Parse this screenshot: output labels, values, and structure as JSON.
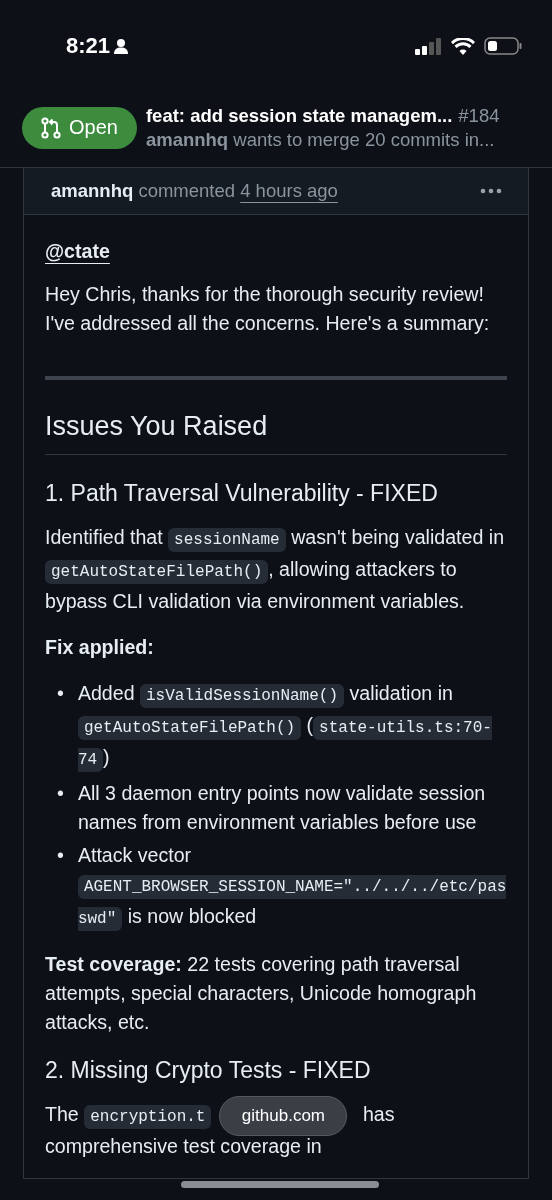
{
  "status_bar": {
    "time": "8:21"
  },
  "header": {
    "state": "Open",
    "title": "feat: add session state managem...",
    "number": "#184",
    "author": "amannhq",
    "subtitle": "wants to merge 20 commits in..."
  },
  "comment": {
    "author": "amannhq",
    "action": "commented",
    "time": "4 hours ago",
    "body": [
      {
        "kind": "mention",
        "text": "@ctate"
      },
      {
        "kind": "paragraph",
        "parts": [
          {
            "kind": "text",
            "text": "Hey Chris, thanks for the thorough security review! I've addressed all the concerns. Here's a summary:"
          }
        ]
      },
      {
        "kind": "rule"
      },
      {
        "kind": "h2",
        "text": "Issues You Raised"
      },
      {
        "kind": "h3",
        "text": "1. Path Traversal Vulnerability - FIXED"
      },
      {
        "kind": "paragraph",
        "parts": [
          {
            "kind": "text",
            "text": "Identified that "
          },
          {
            "kind": "code",
            "text": "sessionName"
          },
          {
            "kind": "text",
            "text": " wasn't being validated in "
          },
          {
            "kind": "code",
            "text": "getAutoStateFilePath()"
          },
          {
            "kind": "text",
            "text": ", allowing attackers to bypass CLI validation via environment variables."
          }
        ]
      },
      {
        "kind": "paragraph",
        "parts": [
          {
            "kind": "text",
            "text": "**Fix applied:**"
          }
        ]
      },
      {
        "kind": "list",
        "items": [
          {
            "bullet": "•",
            "parts": [
              {
                "kind": "text",
                "text": "Added "
              },
              {
                "kind": "code",
                "text": "isValidSessionName()"
              },
              {
                "kind": "text",
                "text": " validation in "
              },
              {
                "kind": "code",
                "text": "getAutoStateFilePath()"
              },
              {
                "kind": "text",
                "text": " ("
              },
              {
                "kind": "code",
                "text": "state-utils.ts:70-74"
              },
              {
                "kind": "text",
                "text": ")"
              }
            ]
          },
          {
            "bullet": "•",
            "parts": [
              {
                "kind": "text",
                "text": "All 3 daemon entry points now validate session names from environment variables before use"
              }
            ]
          },
          {
            "bullet": "•",
            "parts": [
              {
                "kind": "text",
                "text": "Attack vector "
              },
              {
                "kind": "code",
                "text": "AGENT_BROWSER_SESSION_NAME=\"../../../etc/passwd\""
              },
              {
                "kind": "text",
                "text": " is now blocked"
              }
            ]
          }
        ]
      },
      {
        "kind": "paragraph",
        "parts": [
          {
            "kind": "text",
            "text": "**Test coverage:** 22 tests covering path traversal attempts, special characters, Unicode homograph attacks, etc."
          }
        ]
      },
      {
        "kind": "h3",
        "text": "2. Missing Crypto Tests - FIXED"
      },
      {
        "kind": "paragraph",
        "parts": [
          {
            "kind": "text",
            "text": "The "
          },
          {
            "kind": "code",
            "text": "encryption.t"
          },
          {
            "kind": "covered"
          },
          {
            "kind": "text",
            "text": " has"
          },
          {
            "kind": "break"
          },
          {
            "kind": "text",
            "text": "comprehensive test coverage in"
          }
        ]
      }
    ]
  },
  "browser": {
    "url": "github.com"
  }
}
